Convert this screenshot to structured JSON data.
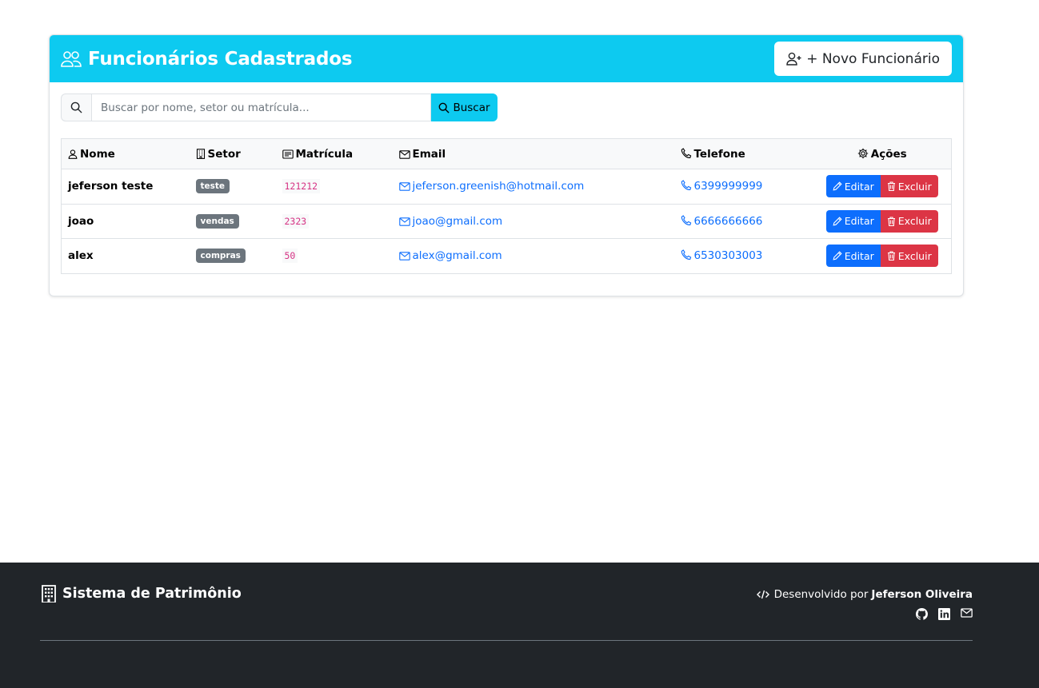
{
  "header": {
    "title": "Funcionários Cadastrados",
    "new_button": "+ Novo Funcionário"
  },
  "search": {
    "placeholder": "Buscar por nome, setor ou matrícula...",
    "button": "Buscar"
  },
  "table": {
    "columns": [
      "Nome",
      "Setor",
      "Matrícula",
      "Email",
      "Telefone",
      "Ações"
    ],
    "rows": [
      {
        "nome": "jeferson teste",
        "setor": "teste",
        "matricula": "121212",
        "email": "jeferson.greenish@hotmail.com",
        "telefone": "6399999999"
      },
      {
        "nome": "joao",
        "setor": "vendas",
        "matricula": "2323",
        "email": "joao@gmail.com",
        "telefone": "6666666666"
      },
      {
        "nome": "alex",
        "setor": "compras",
        "matricula": "50",
        "email": "alex@gmail.com",
        "telefone": "6530303003"
      }
    ],
    "edit_label": "Editar",
    "delete_label": "Excluir"
  },
  "footer": {
    "brand": "Sistema de Patrimônio",
    "dev_prefix": "Desenvolvido por",
    "dev_name": "Jeferson Oliveira",
    "social_icons": [
      "github-icon",
      "linkedin-icon",
      "envelope-icon"
    ]
  },
  "colors": {
    "header": "#0dcaf0",
    "primary": "#0d6efd",
    "danger": "#dc3545",
    "secondary": "#6c757d",
    "code": "#d63384",
    "footer": "#212529"
  }
}
